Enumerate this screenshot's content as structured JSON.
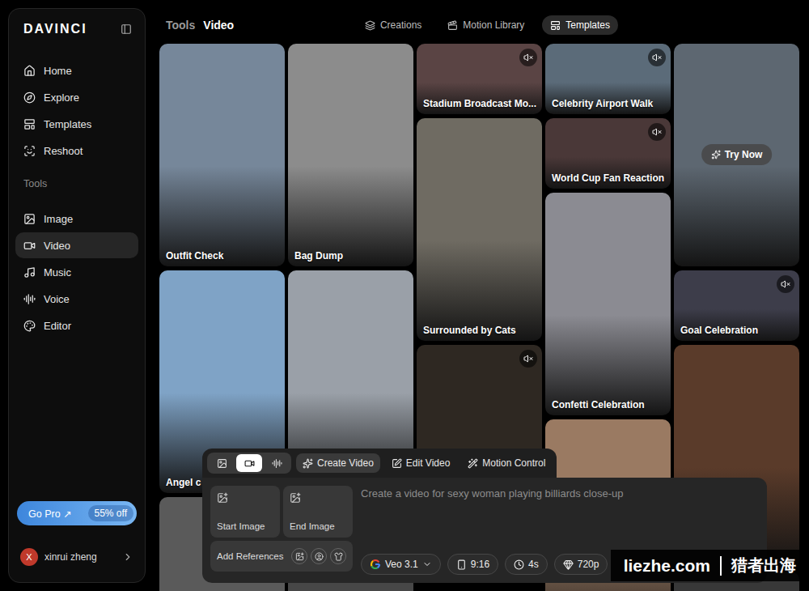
{
  "app": {
    "logo": "DAVINCI"
  },
  "sidebar": {
    "nav": [
      {
        "label": "Home",
        "selected": false
      },
      {
        "label": "Explore",
        "selected": false
      },
      {
        "label": "Templates",
        "selected": false
      },
      {
        "label": "Reshoot",
        "selected": false
      }
    ],
    "section": "Tools",
    "tools": [
      {
        "label": "Image",
        "selected": false
      },
      {
        "label": "Video",
        "selected": true
      },
      {
        "label": "Music",
        "selected": false
      },
      {
        "label": "Voice",
        "selected": false
      },
      {
        "label": "Editor",
        "selected": false
      }
    ],
    "promo": {
      "label": "Go Pro ↗",
      "badge": "55% off"
    },
    "user": {
      "initial": "X",
      "name": "xinrui zheng"
    }
  },
  "breadcrumb": [
    "Tools",
    "Video"
  ],
  "tabs": [
    {
      "label": "Creations",
      "selected": false
    },
    {
      "label": "Motion Library",
      "selected": false
    },
    {
      "label": "Templates",
      "selected": true
    }
  ],
  "gallery": {
    "columns": [
      [
        {
          "label": "Outfit Check",
          "kind": "tall",
          "audio": false,
          "color": "#76879a"
        },
        {
          "label": "Angel c",
          "kind": "tall",
          "audio": false,
          "color": "#7fa3c6"
        },
        {
          "kind": "tall",
          "audio": false,
          "color": "#5a5a5a"
        }
      ],
      [
        {
          "label": "Bag Dump",
          "kind": "tall",
          "audio": false,
          "color": "#8c8c8c"
        },
        {
          "kind": "tall",
          "audio": false,
          "color": "#9aa0a8"
        },
        {
          "kind": "tall",
          "audio": false,
          "color": "#474747"
        }
      ],
      [
        {
          "label": "Stadium Broadcast Mo...",
          "kind": "short",
          "audio": true,
          "color": "#5a4444"
        },
        {
          "label": "Surrounded by Cats",
          "kind": "tall",
          "audio": false,
          "color": "#6f6b62"
        },
        {
          "kind": "tall",
          "audio": true,
          "color": "#2e2822"
        }
      ],
      [
        {
          "label": "Celebrity Airport Walk",
          "kind": "short",
          "audio": true,
          "color": "#5b6b79"
        },
        {
          "label": "World Cup Fan Reaction",
          "kind": "short",
          "audio": true,
          "color": "#4a3838"
        },
        {
          "label": "Confetti Celebration",
          "kind": "tall",
          "audio": false,
          "color": "#8b8b92"
        },
        {
          "kind": "tall",
          "audio": false,
          "color": "#9a7a62"
        }
      ],
      [
        {
          "kind": "tall",
          "audio": false,
          "color": "#5d6771",
          "action": "Try Now"
        },
        {
          "label": "Goal Celebration",
          "kind": "short",
          "audio": true,
          "color": "#3d3d4a"
        },
        {
          "kind": "tall",
          "audio": false,
          "color": "#5a3b2a"
        },
        {
          "kind": "tall",
          "audio": false,
          "color": "#383838"
        }
      ]
    ]
  },
  "composer": {
    "modes": [
      {
        "kind": "image",
        "selected": false
      },
      {
        "kind": "video",
        "selected": true
      },
      {
        "kind": "audio",
        "selected": false
      }
    ],
    "tabs": [
      {
        "label": "Create Video",
        "selected": true
      },
      {
        "label": "Edit Video",
        "selected": false
      },
      {
        "label": "Motion Control",
        "selected": false
      }
    ],
    "slots": [
      "Start Image",
      "End Image"
    ],
    "references": "Add References",
    "placeholder": "Create a video for sexy woman playing billiards close-up",
    "options": [
      {
        "kind": "model",
        "label": "Veo 3.1"
      },
      {
        "kind": "ratio",
        "label": "9:16"
      },
      {
        "kind": "duration",
        "label": "4s"
      },
      {
        "kind": "quality",
        "label": "720p"
      }
    ]
  },
  "watermark": {
    "site": "liezhe.com",
    "brand": "猎者出海"
  }
}
